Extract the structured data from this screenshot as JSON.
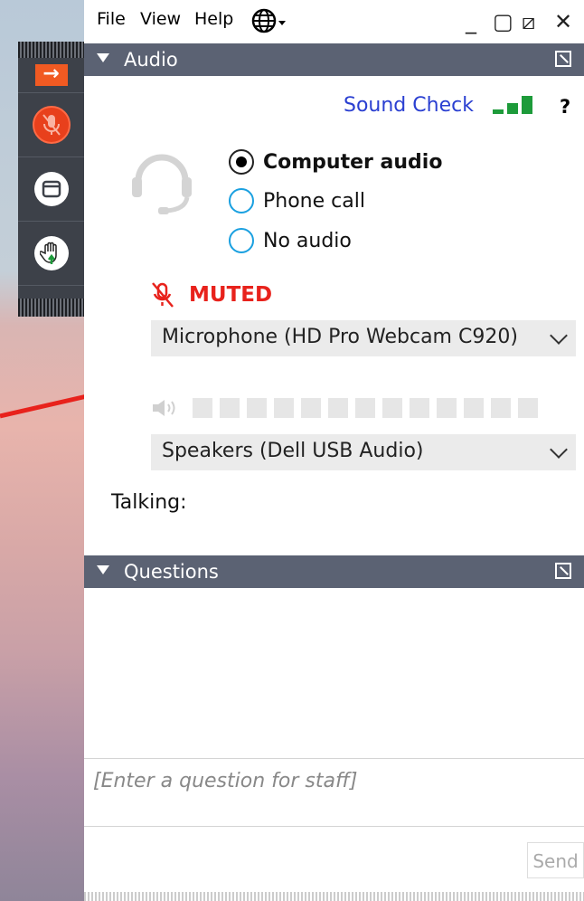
{
  "menu": {
    "file": "File",
    "view": "View",
    "help": "Help"
  },
  "window_controls": {
    "minimize": "_",
    "maximize": "▢",
    "restore": "⧄",
    "close": "✕"
  },
  "strip": {
    "buttons": [
      {
        "icon": "arrow-right-icon",
        "glyph": "→"
      },
      {
        "icon": "mic-muted-icon"
      },
      {
        "icon": "window-icon"
      },
      {
        "icon": "raise-hand-icon"
      }
    ]
  },
  "audio": {
    "header": "Audio",
    "sound_check": "Sound Check",
    "help": "?",
    "options": [
      {
        "label": "Computer audio",
        "selected": true
      },
      {
        "label": "Phone call",
        "selected": false
      },
      {
        "label": "No audio",
        "selected": false
      }
    ],
    "muted_label": "MUTED",
    "microphone": "Microphone (HD Pro Webcam C920)",
    "speakers": "Speakers (Dell USB Audio)",
    "talking_label": "Talking:",
    "level_segments": 13
  },
  "questions": {
    "header": "Questions",
    "placeholder": "[Enter a question for staff]",
    "send": "Send"
  },
  "colors": {
    "header_bg": "#5b6273",
    "muted": "#e8221c",
    "link": "#2a3fd1",
    "signal": "#1d9b3a",
    "radio": "#1aa0e0",
    "annotation_arrow": "#e8221c"
  }
}
